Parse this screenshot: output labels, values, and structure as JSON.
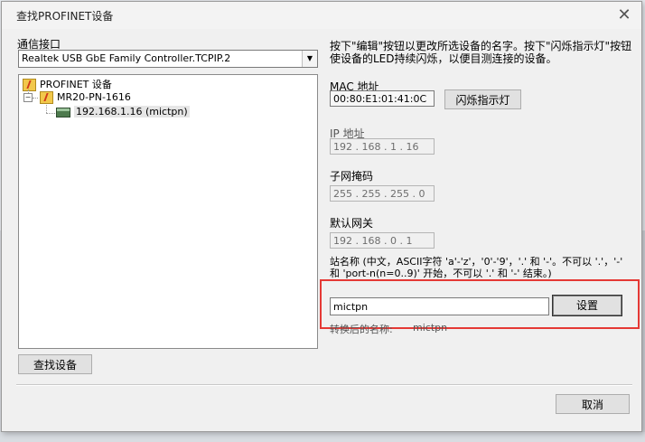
{
  "window": {
    "title": "查找PROFINET设备"
  },
  "interface": {
    "label": "通信接口",
    "selected": "Realtek USB GbE Family Controller.TCPIP.2"
  },
  "tree": {
    "root": "PROFINET 设备",
    "device": "MR20-PN-1616",
    "child": "192.168.1.16 (mictpn)"
  },
  "help_text": {
    "line1": "按下\"编辑\"按钮以更改所选设备的名字。按下\"闪烁指示灯\"按钮",
    "line2": "使设备的LED持续闪烁，以便目测连接的设备。"
  },
  "mac": {
    "label": "MAC 地址",
    "value": "00:80:E1:01:41:0C",
    "flash_button": "闪烁指示灯"
  },
  "ip": {
    "label": "IP 地址",
    "value": "192 . 168 .  1  .  16"
  },
  "subnet": {
    "label": "子网掩码",
    "value": "255 . 255 . 255 .  0"
  },
  "gateway": {
    "label": "默认网关",
    "value": "192 . 168 .  0  .  1"
  },
  "station": {
    "note_line1": "站名称 (中文，ASCII字符 'a'-'z'，'0'-'9'，'.' 和 '-'。不可以 '.'，'-'",
    "note_line2": "和 'port-n(n=0..9)' 开始，不可以 '.' 和 '-' 结束。)",
    "name_value": "mictpn",
    "set_button": "设置",
    "converted_label": "转换后的名称:",
    "converted_value": "mictpn"
  },
  "buttons": {
    "search": "查找设备",
    "cancel": "取消"
  },
  "colors": {
    "highlight": "#e53935"
  }
}
